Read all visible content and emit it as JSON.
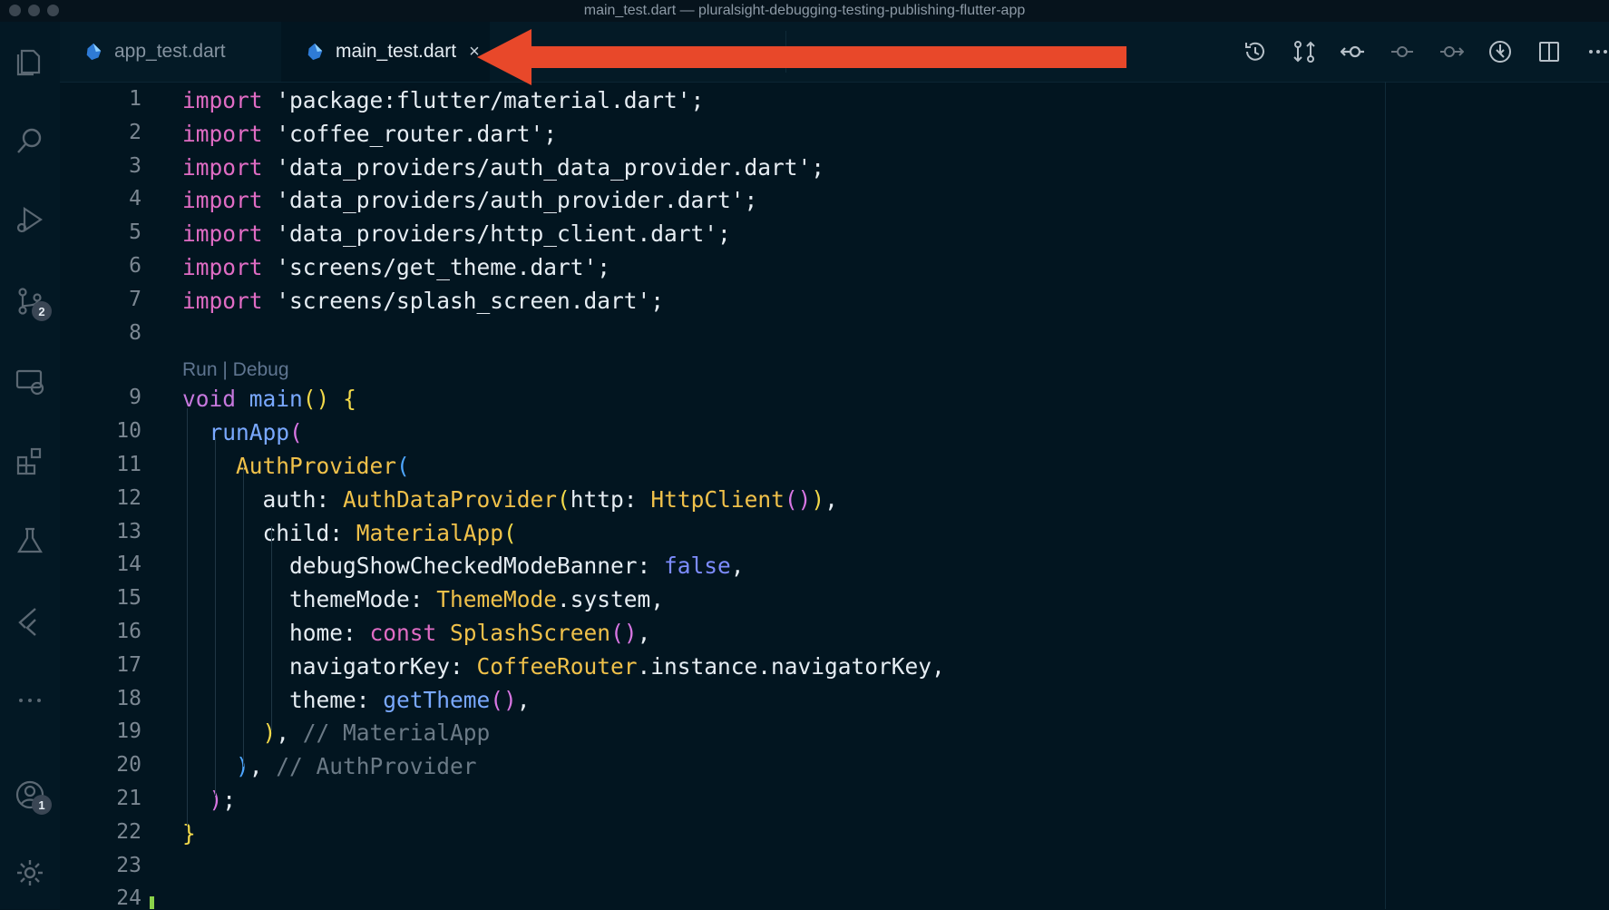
{
  "window": {
    "title": "main_test.dart — pluralsight-debugging-testing-publishing-flutter-app"
  },
  "activity_bar": {
    "source_control_badge": "2",
    "accounts_badge": "1",
    "icons": [
      "explorer-icon",
      "search-icon",
      "run-debug-icon",
      "source-control-icon",
      "remote-explorer-icon",
      "extensions-icon",
      "testing-icon",
      "flutter-icon",
      "more-icon",
      "accounts-icon",
      "settings-icon"
    ]
  },
  "tabs": [
    {
      "label": "app_test.dart",
      "active": false
    },
    {
      "label": "main_test.dart",
      "active": true,
      "close": "×"
    }
  ],
  "colors": {
    "annotation_arrow": "#e8482a",
    "background": "#021520",
    "keyword": "#c678dd",
    "class": "#f0c14a",
    "function": "#7aa9ff",
    "comment": "#6b7a86"
  },
  "editor": {
    "codelens": "Run | Debug",
    "line_numbers": [
      "1",
      "2",
      "3",
      "4",
      "5",
      "6",
      "7",
      "8",
      "9",
      "10",
      "11",
      "12",
      "13",
      "14",
      "15",
      "16",
      "17",
      "18",
      "19",
      "20",
      "21",
      "22",
      "23",
      "24"
    ],
    "lines": [
      [
        {
          "t": "import",
          "c": "kw2"
        },
        {
          "t": " 'package:flutter/material.dart';",
          "c": "str"
        }
      ],
      [
        {
          "t": "import",
          "c": "kw2"
        },
        {
          "t": " 'coffee_router.dart';",
          "c": "str"
        }
      ],
      [
        {
          "t": "import",
          "c": "kw2"
        },
        {
          "t": " 'data_providers/auth_data_provider.dart';",
          "c": "str"
        }
      ],
      [
        {
          "t": "import",
          "c": "kw2"
        },
        {
          "t": " 'data_providers/auth_provider.dart';",
          "c": "str"
        }
      ],
      [
        {
          "t": "import",
          "c": "kw2"
        },
        {
          "t": " 'data_providers/http_client.dart';",
          "c": "str"
        }
      ],
      [
        {
          "t": "import",
          "c": "kw2"
        },
        {
          "t": " 'screens/get_theme.dart';",
          "c": "str"
        }
      ],
      [
        {
          "t": "import",
          "c": "kw2"
        },
        {
          "t": " 'screens/splash_screen.dart';",
          "c": "str"
        }
      ],
      [],
      [
        {
          "t": "void",
          "c": "kw"
        },
        {
          "t": " ",
          "c": "str"
        },
        {
          "t": "main",
          "c": "fn"
        },
        {
          "t": "()",
          "c": "p1"
        },
        {
          "t": " ",
          "c": "str"
        },
        {
          "t": "{",
          "c": "p1"
        }
      ],
      [
        {
          "t": "  ",
          "c": "str"
        },
        {
          "t": "runApp",
          "c": "fn"
        },
        {
          "t": "(",
          "c": "p2"
        }
      ],
      [
        {
          "t": "    ",
          "c": "str"
        },
        {
          "t": "AuthProvider",
          "c": "cls"
        },
        {
          "t": "(",
          "c": "p3"
        }
      ],
      [
        {
          "t": "      auth: ",
          "c": "prop"
        },
        {
          "t": "AuthDataProvider",
          "c": "cls"
        },
        {
          "t": "(",
          "c": "p1"
        },
        {
          "t": "http: ",
          "c": "prop"
        },
        {
          "t": "HttpClient",
          "c": "cls"
        },
        {
          "t": "()",
          "c": "p2"
        },
        {
          "t": ")",
          "c": "p1"
        },
        {
          "t": ",",
          "c": "str"
        }
      ],
      [
        {
          "t": "      child: ",
          "c": "prop"
        },
        {
          "t": "MaterialApp",
          "c": "cls"
        },
        {
          "t": "(",
          "c": "p1"
        }
      ],
      [
        {
          "t": "        debugShowCheckedModeBanner: ",
          "c": "prop"
        },
        {
          "t": "false",
          "c": "bool"
        },
        {
          "t": ",",
          "c": "str"
        }
      ],
      [
        {
          "t": "        themeMode: ",
          "c": "prop"
        },
        {
          "t": "ThemeMode",
          "c": "cls"
        },
        {
          "t": ".system,",
          "c": "str"
        }
      ],
      [
        {
          "t": "        home: ",
          "c": "prop"
        },
        {
          "t": "const",
          "c": "kw2"
        },
        {
          "t": " ",
          "c": "str"
        },
        {
          "t": "SplashScreen",
          "c": "cls"
        },
        {
          "t": "()",
          "c": "p2"
        },
        {
          "t": ",",
          "c": "str"
        }
      ],
      [
        {
          "t": "        navigatorKey: ",
          "c": "prop"
        },
        {
          "t": "CoffeeRouter",
          "c": "cls"
        },
        {
          "t": ".instance.navigatorKey,",
          "c": "str"
        }
      ],
      [
        {
          "t": "        theme: ",
          "c": "prop"
        },
        {
          "t": "getTheme",
          "c": "fn"
        },
        {
          "t": "()",
          "c": "p2"
        },
        {
          "t": ",",
          "c": "str"
        }
      ],
      [
        {
          "t": "      ",
          "c": "str"
        },
        {
          "t": ")",
          "c": "p1"
        },
        {
          "t": ", ",
          "c": "str"
        },
        {
          "t": "// MaterialApp",
          "c": "cmt"
        }
      ],
      [
        {
          "t": "    ",
          "c": "str"
        },
        {
          "t": ")",
          "c": "p3"
        },
        {
          "t": ", ",
          "c": "str"
        },
        {
          "t": "// AuthProvider",
          "c": "cmt"
        }
      ],
      [
        {
          "t": "  ",
          "c": "str"
        },
        {
          "t": ")",
          "c": "p2"
        },
        {
          "t": ";",
          "c": "str"
        }
      ],
      [
        {
          "t": "}",
          "c": "p1"
        }
      ],
      [],
      []
    ]
  }
}
